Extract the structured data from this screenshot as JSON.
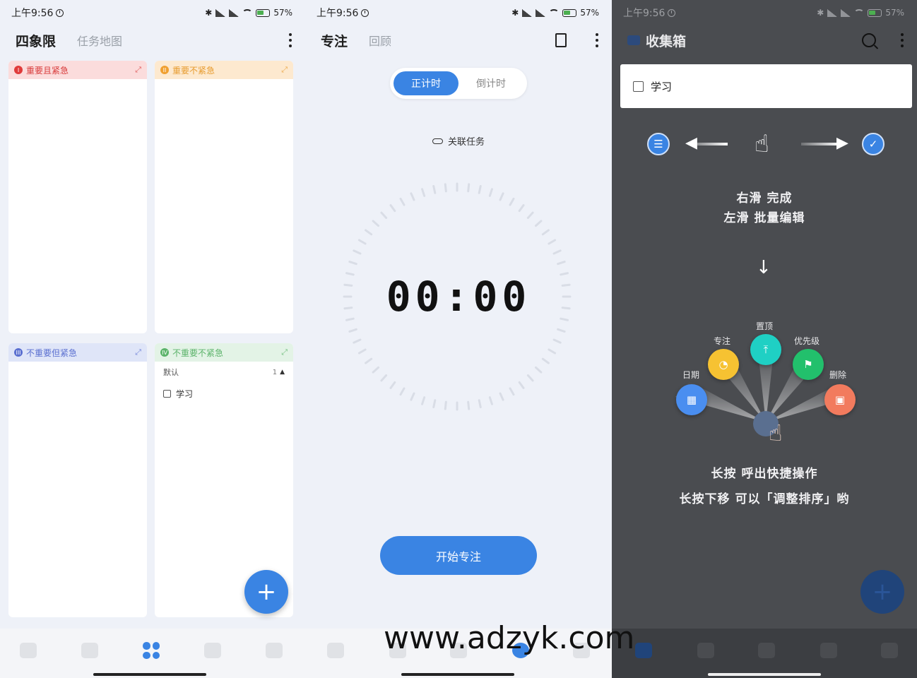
{
  "status_bar": {
    "time": "上午9:56",
    "battery": "57",
    "battery_unit": "%"
  },
  "quadrant_screen": {
    "title": "四象限",
    "subtitle": "任务地图",
    "quadrants": [
      {
        "label": "重要且紧急",
        "icon": "roman-1-icon",
        "numeral": "I",
        "color": "#e03b3b"
      },
      {
        "label": "重要不紧急",
        "icon": "roman-2-icon",
        "numeral": "II",
        "color": "#f0a030"
      },
      {
        "label": "不重要但紧急",
        "icon": "roman-3-icon",
        "numeral": "III",
        "color": "#5a6fd0"
      },
      {
        "label": "不重要不紧急",
        "icon": "roman-4-icon",
        "numeral": "IV",
        "color": "#5bb36a"
      }
    ],
    "q4_group": {
      "name": "默认",
      "count": "1"
    },
    "q4_task": "学习",
    "fab": "+"
  },
  "focus_screen": {
    "title": "专注",
    "subtitle": "回顾",
    "tab_countup": "正计时",
    "tab_countdown": "倒计时",
    "link_task": "关联任务",
    "timer": "00:00",
    "start_button": "开始专注"
  },
  "inbox_screen": {
    "title": "收集箱",
    "task": "学习",
    "hint_swipe_right": "右滑 完成",
    "hint_swipe_left": "左滑 批量编辑",
    "radial_labels": {
      "date": "日期",
      "focus": "专注",
      "pin": "置顶",
      "priority": "优先级",
      "delete": "删除"
    },
    "hint_long_press": "长按 呼出快捷操作",
    "hint_reorder": "长按下移 可以「调整排序」哟",
    "fab": "+"
  },
  "watermark": "www.adzyk.com",
  "colors": {
    "accent": "#3a84e3",
    "page_bg": "#eef1f8",
    "dark_bg": "#4a4c50"
  }
}
